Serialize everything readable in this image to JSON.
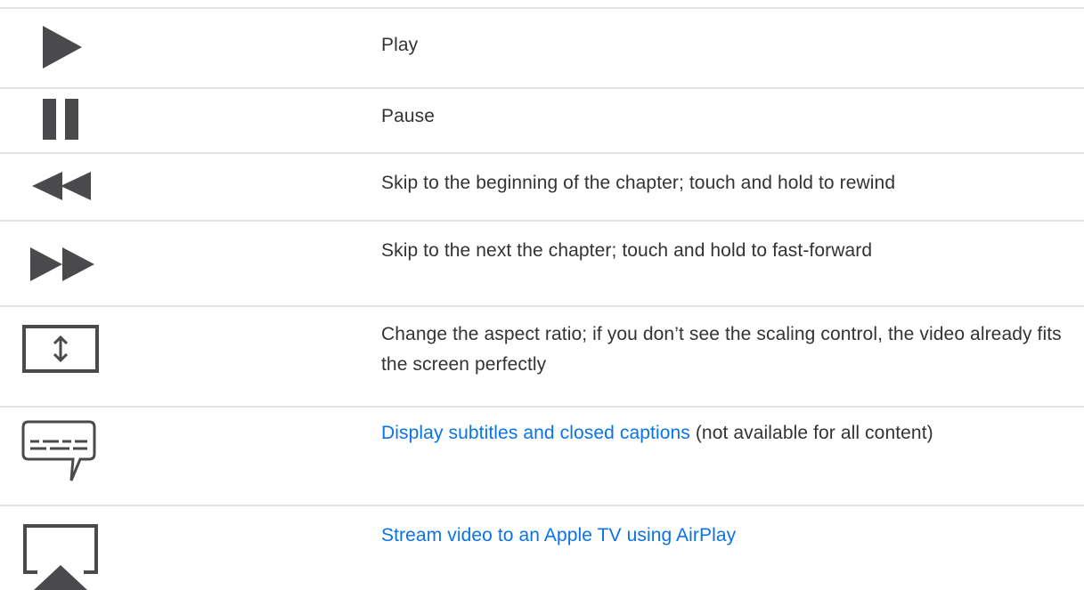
{
  "colors": {
    "icon": "#4a4a4c",
    "text": "#333336",
    "link": "#0a73e6",
    "divider": "#e3e3e5"
  },
  "rows": [
    {
      "icon": "play-icon",
      "text": "Play"
    },
    {
      "icon": "pause-icon",
      "text": "Pause"
    },
    {
      "icon": "rewind-icon",
      "text": "Skip to the beginning of the chapter; touch and hold to rewind"
    },
    {
      "icon": "fast-forward-icon",
      "text": "Skip to the next the chapter; touch and hold to fast-forward"
    },
    {
      "icon": "aspect-ratio-icon",
      "text": "Change the aspect ratio; if you don’t see the scaling control, the video already fits the screen perfectly"
    },
    {
      "icon": "subtitles-icon",
      "link_text": "Display subtitles and closed captions",
      "text": " (not available for all content)"
    },
    {
      "icon": "airplay-icon",
      "link_text": "Stream video to an Apple TV using AirPlay"
    }
  ]
}
